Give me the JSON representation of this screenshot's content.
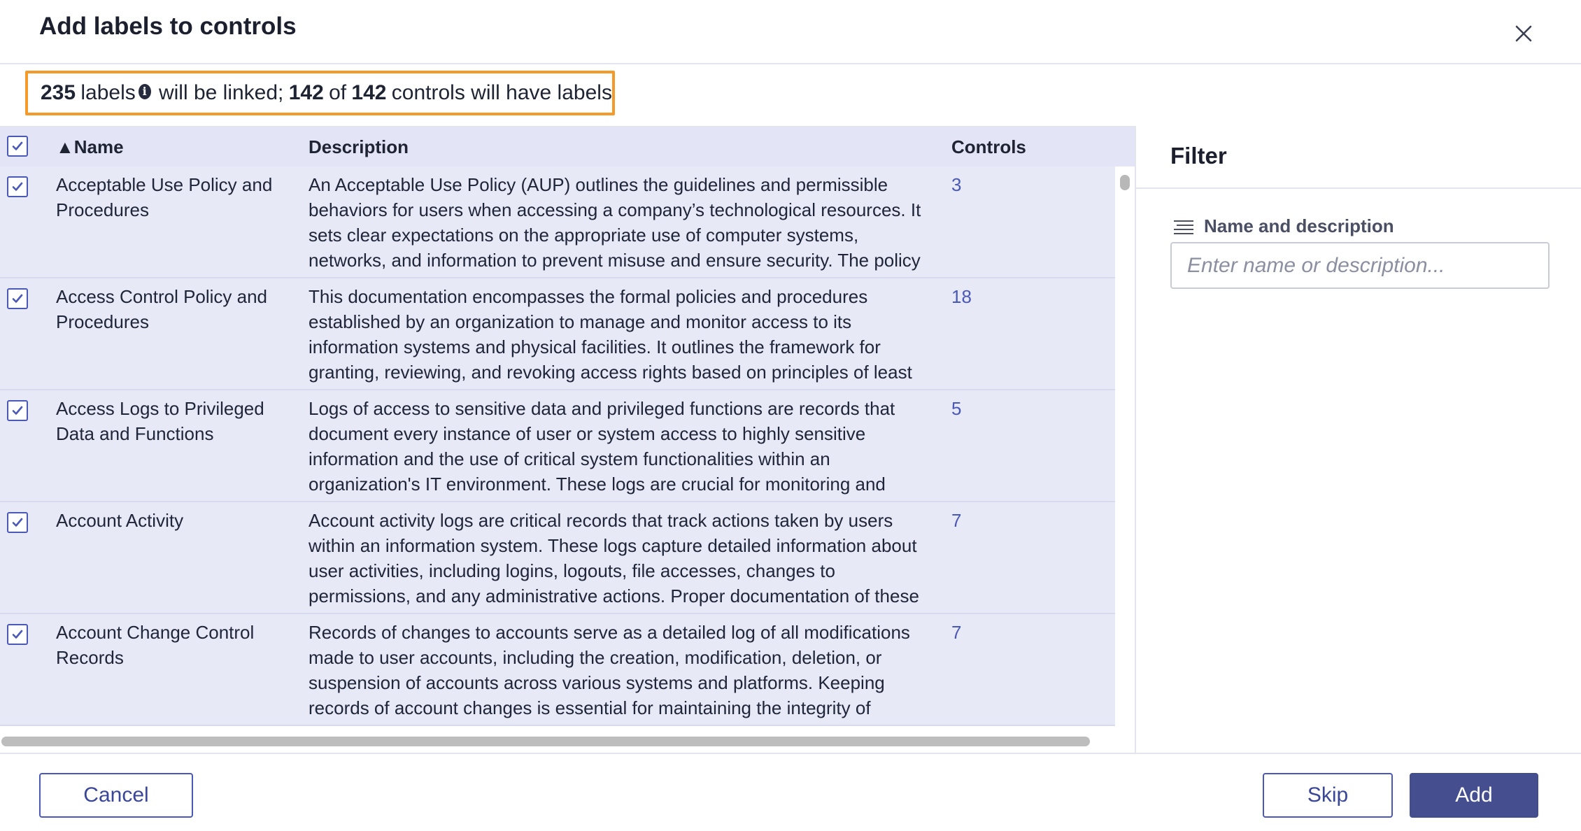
{
  "dialog": {
    "title": "Add labels to controls",
    "close_icon": "close-icon"
  },
  "summary": {
    "labels_count": "235",
    "labels_word": "labels",
    "info_icon": "info-icon",
    "linked_text": "will be linked;",
    "controls_with_labels": "142",
    "of_word": "of",
    "controls_total": "142",
    "controls_text": "controls will have labels"
  },
  "table": {
    "columns": {
      "sort_indicator": "▲",
      "name": "Name",
      "description": "Description",
      "controls": "Controls"
    },
    "rows": [
      {
        "name": "Acceptable Use Policy and Procedures",
        "description": "An Acceptable Use Policy (AUP) outlines the guidelines and permissible behaviors for users when accessing a company’s technological resources. It sets clear expectations on the appropriate use of computer systems, networks, and information to prevent misuse and ensure security. The policy typically",
        "controls": "3"
      },
      {
        "name": "Access Control Policy and Procedures",
        "description": "This documentation encompasses the formal policies and procedures established by an organization to manage and monitor access to its information systems and physical facilities. It outlines the framework for granting, reviewing, and revoking access rights based on principles of least",
        "controls": "18"
      },
      {
        "name": "Access Logs to Privileged Data and Functions",
        "description": "Logs of access to sensitive data and privileged functions are records that document every instance of user or system access to highly sensitive information and the use of critical system functionalities within an organization's IT environment. These logs are crucial for monitoring and",
        "controls": "5"
      },
      {
        "name": "Account Activity",
        "description": "Account activity logs are critical records that track actions taken by users within an information system. These logs capture detailed information about user activities, including logins, logouts, file accesses, changes to permissions, and any administrative actions. Proper documentation of these logs is essential for",
        "controls": "7"
      },
      {
        "name": "Account Change Control Records",
        "description": "Records of changes to accounts serve as a detailed log of all modifications made to user accounts, including the creation, modification, deletion, or suspension of accounts across various systems and platforms. Keeping records of account changes is essential for maintaining the integrity of access control,",
        "controls": "7"
      }
    ]
  },
  "filter": {
    "title": "Filter",
    "field_icon": "lines-icon",
    "field_label": "Name and description",
    "placeholder": "Enter name or description..."
  },
  "footer": {
    "cancel_label": "Cancel",
    "skip_label": "Skip",
    "add_label": "Add"
  },
  "colors": {
    "accent": "#4a58b8",
    "primary_button": "#454f90",
    "highlight_border": "#f39a2b",
    "row_background": "#e8e9f7",
    "header_background": "#e3e4f6"
  }
}
